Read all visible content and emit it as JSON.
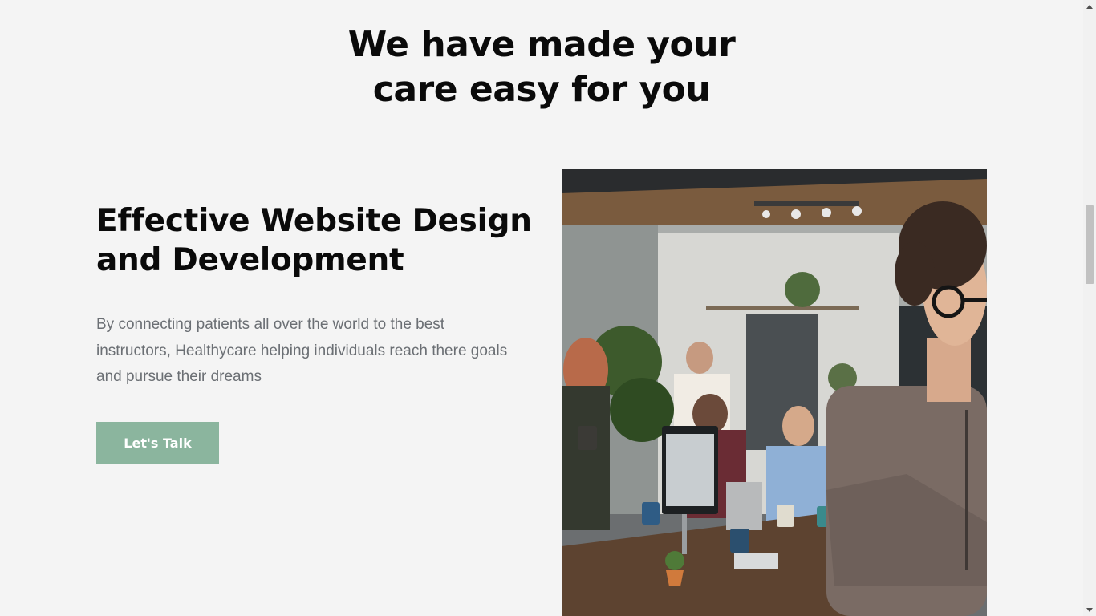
{
  "section": {
    "title_line1": "We have made your",
    "title_line2": "care easy for you"
  },
  "feature": {
    "heading_line1": "Effective Website Design",
    "heading_line2": "and Development",
    "description": "By connecting patients all over the world to the best instructors, Healthycare helping individuals reach there goals and pursue their dreams",
    "button_label": "Let's Talk",
    "image_subject": "team-meeting-photo"
  },
  "colors": {
    "background": "#f4f4f4",
    "heading": "#0a0a0a",
    "body_text": "#6b6f74",
    "button": "#8bb59e",
    "button_text": "#ffffff"
  },
  "icons": {
    "scroll_up": "triangle-up-icon",
    "scroll_down": "triangle-down-icon"
  }
}
